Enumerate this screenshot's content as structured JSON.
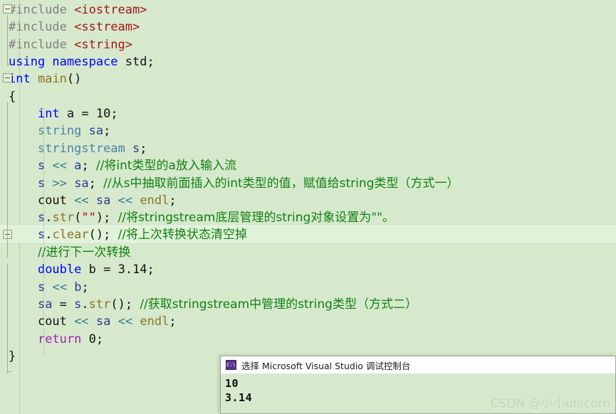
{
  "editor": {
    "background": "#d6e9cd",
    "lines": [
      {
        "id": "l1",
        "fold": "start",
        "tokens": [
          {
            "t": "#include ",
            "c": "pp"
          },
          {
            "t": "<iostream>",
            "c": "inc"
          }
        ]
      },
      {
        "id": "l2",
        "fold": "mid",
        "tokens": [
          {
            "t": "#include ",
            "c": "pp"
          },
          {
            "t": "<sstream>",
            "c": "inc"
          }
        ]
      },
      {
        "id": "l3",
        "fold": "end",
        "tokens": [
          {
            "t": "#include ",
            "c": "pp"
          },
          {
            "t": "<string>",
            "c": "inc"
          }
        ]
      },
      {
        "id": "l4",
        "fold": "none",
        "tokens": [
          {
            "t": "using namespace ",
            "c": "kw"
          },
          {
            "t": "std;",
            "c": "plain"
          }
        ]
      },
      {
        "id": "l5",
        "fold": "start",
        "tokens": [
          {
            "t": "int",
            "c": "kw"
          },
          {
            "t": " ",
            "c": "plain"
          },
          {
            "t": "main",
            "c": "fn"
          },
          {
            "t": "()",
            "c": "plain"
          }
        ]
      },
      {
        "id": "l6",
        "fold": "mid",
        "tokens": [
          {
            "t": "{",
            "c": "plain"
          }
        ]
      },
      {
        "id": "l7",
        "fold": "mid",
        "tokens": [
          {
            "t": "    ",
            "c": "plain"
          },
          {
            "t": "int",
            "c": "kw"
          },
          {
            "t": " a ",
            "c": "plain"
          },
          {
            "t": "= ",
            "c": "plain"
          },
          {
            "t": "10",
            "c": "num"
          },
          {
            "t": ";",
            "c": "plain"
          }
        ]
      },
      {
        "id": "l8",
        "fold": "mid",
        "tokens": [
          {
            "t": "    ",
            "c": "plain"
          },
          {
            "t": "string",
            "c": "type"
          },
          {
            "t": " ",
            "c": "plain"
          },
          {
            "t": "sa",
            "c": "var"
          },
          {
            "t": ";",
            "c": "plain"
          }
        ]
      },
      {
        "id": "l9",
        "fold": "mid",
        "tokens": [
          {
            "t": "    ",
            "c": "plain"
          },
          {
            "t": "stringstream",
            "c": "type"
          },
          {
            "t": " ",
            "c": "plain"
          },
          {
            "t": "s",
            "c": "var"
          },
          {
            "t": ";",
            "c": "plain"
          }
        ]
      },
      {
        "id": "l10",
        "fold": "mid",
        "tokens": [
          {
            "t": "    ",
            "c": "plain"
          },
          {
            "t": "s",
            "c": "var"
          },
          {
            "t": " ",
            "c": "plain"
          },
          {
            "t": "<<",
            "c": "op"
          },
          {
            "t": " ",
            "c": "plain"
          },
          {
            "t": "a",
            "c": "var"
          },
          {
            "t": "; ",
            "c": "plain"
          },
          {
            "t": "//将int类型的a放入输入流",
            "c": "cmt cn"
          }
        ]
      },
      {
        "id": "l11",
        "fold": "mid",
        "tokens": [
          {
            "t": "    ",
            "c": "plain"
          },
          {
            "t": "s",
            "c": "var"
          },
          {
            "t": " ",
            "c": "plain"
          },
          {
            "t": ">>",
            "c": "op"
          },
          {
            "t": " ",
            "c": "plain"
          },
          {
            "t": "sa",
            "c": "var"
          },
          {
            "t": "; ",
            "c": "plain"
          },
          {
            "t": "//从s中抽取前面插入的int类型的值，赋值给string类型（方式一）",
            "c": "cmt cn"
          }
        ]
      },
      {
        "id": "l12",
        "fold": "mid",
        "tokens": [
          {
            "t": "    ",
            "c": "plain"
          },
          {
            "t": "cout",
            "c": "plain"
          },
          {
            "t": " ",
            "c": "plain"
          },
          {
            "t": "<<",
            "c": "op"
          },
          {
            "t": " ",
            "c": "plain"
          },
          {
            "t": "sa",
            "c": "var"
          },
          {
            "t": " ",
            "c": "plain"
          },
          {
            "t": "<<",
            "c": "op"
          },
          {
            "t": " ",
            "c": "plain"
          },
          {
            "t": "endl",
            "c": "fn"
          },
          {
            "t": ";",
            "c": "plain"
          }
        ]
      },
      {
        "id": "l13",
        "fold": "mid",
        "tokens": [
          {
            "t": "    ",
            "c": "plain"
          },
          {
            "t": "s",
            "c": "var"
          },
          {
            "t": ".",
            "c": "plain"
          },
          {
            "t": "str",
            "c": "fn"
          },
          {
            "t": "(",
            "c": "plain"
          },
          {
            "t": "\"\"",
            "c": "str"
          },
          {
            "t": "); ",
            "c": "plain"
          },
          {
            "t": "//将stringstream底层管理的string对象设置为\"\"。",
            "c": "cmt cn"
          }
        ]
      },
      {
        "id": "l14",
        "fold": "current",
        "current": true,
        "tokens": [
          {
            "t": "    ",
            "c": "plain"
          },
          {
            "t": "s",
            "c": "var"
          },
          {
            "t": ".",
            "c": "plain"
          },
          {
            "t": "clear",
            "c": "fn"
          },
          {
            "t": "(); ",
            "c": "plain"
          },
          {
            "t": "//将上次转换状态清空掉",
            "c": "cmt cn"
          }
        ]
      },
      {
        "id": "l15",
        "fold": "mid",
        "tokens": [
          {
            "t": "    ",
            "c": "plain"
          },
          {
            "t": "//进行下一次转换",
            "c": "cmt cn"
          }
        ]
      },
      {
        "id": "l16",
        "fold": "mid",
        "tokens": [
          {
            "t": "    ",
            "c": "plain"
          },
          {
            "t": "double",
            "c": "kw"
          },
          {
            "t": " b ",
            "c": "plain"
          },
          {
            "t": "= ",
            "c": "plain"
          },
          {
            "t": "3.14",
            "c": "num"
          },
          {
            "t": ";",
            "c": "plain"
          }
        ]
      },
      {
        "id": "l17",
        "fold": "mid",
        "tokens": [
          {
            "t": "    ",
            "c": "plain"
          },
          {
            "t": "s",
            "c": "var"
          },
          {
            "t": " ",
            "c": "plain"
          },
          {
            "t": "<<",
            "c": "op"
          },
          {
            "t": " ",
            "c": "plain"
          },
          {
            "t": "b",
            "c": "var"
          },
          {
            "t": ";",
            "c": "plain"
          }
        ]
      },
      {
        "id": "l18",
        "fold": "mid",
        "tokens": [
          {
            "t": "    ",
            "c": "plain"
          },
          {
            "t": "sa",
            "c": "var"
          },
          {
            "t": " = ",
            "c": "plain"
          },
          {
            "t": "s",
            "c": "var"
          },
          {
            "t": ".",
            "c": "plain"
          },
          {
            "t": "str",
            "c": "fn"
          },
          {
            "t": "(); ",
            "c": "plain"
          },
          {
            "t": "//获取stringstream中管理的string类型（方式二）",
            "c": "cmt cn"
          }
        ]
      },
      {
        "id": "l19",
        "fold": "mid",
        "tokens": [
          {
            "t": "    ",
            "c": "plain"
          },
          {
            "t": "cout",
            "c": "plain"
          },
          {
            "t": " ",
            "c": "plain"
          },
          {
            "t": "<<",
            "c": "op"
          },
          {
            "t": " ",
            "c": "plain"
          },
          {
            "t": "sa",
            "c": "var"
          },
          {
            "t": " ",
            "c": "plain"
          },
          {
            "t": "<<",
            "c": "op"
          },
          {
            "t": " ",
            "c": "plain"
          },
          {
            "t": "endl",
            "c": "fn"
          },
          {
            "t": ";",
            "c": "plain"
          }
        ]
      },
      {
        "id": "l20",
        "fold": "mid",
        "tokens": [
          {
            "t": "    ",
            "c": "plain"
          },
          {
            "t": "return",
            "c": "kw2"
          },
          {
            "t": " ",
            "c": "plain"
          },
          {
            "t": "0",
            "c": "num"
          },
          {
            "t": ";",
            "c": "plain"
          }
        ]
      },
      {
        "id": "l21",
        "fold": "blockend",
        "tokens": [
          {
            "t": "}",
            "c": "plain"
          }
        ]
      }
    ]
  },
  "console": {
    "icon_label": "C:\\",
    "title": "选择 Microsoft Visual Studio 调试控制台",
    "output": [
      "10",
      "3.14"
    ]
  },
  "watermark": {
    "text": "CSDN @小小unicorn"
  }
}
